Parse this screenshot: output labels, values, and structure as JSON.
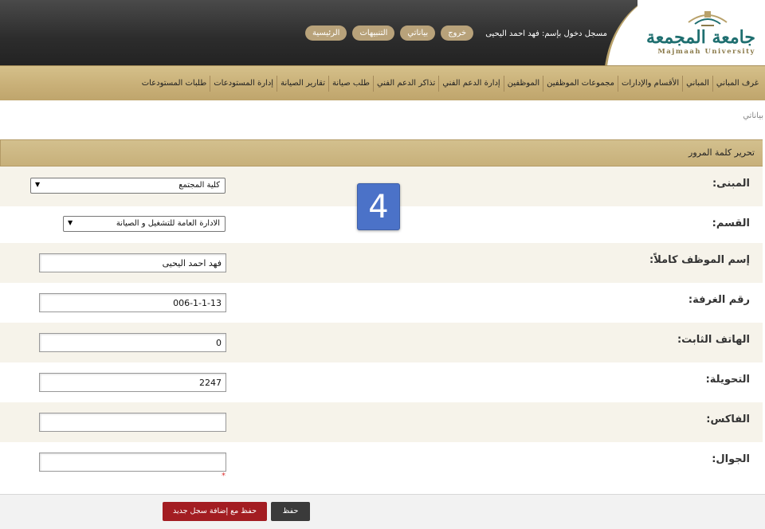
{
  "header": {
    "logo_arabic": "جامعة المجمعة",
    "logo_english": "Majmaah University",
    "logged_in_label": "مسجل دخول بإسم:",
    "user_name": "فهد احمد اليحيى",
    "links": [
      "الرئيسية",
      "التنبيهات",
      "بياناتي",
      "خروج"
    ]
  },
  "nav": {
    "items": [
      "غرف المباني",
      "المباني",
      "الأقسام والإدارات",
      "مجموعات الموظفين",
      "الموظفين",
      "إدارة الدعم الفني",
      "تذاكر الدعم الفني",
      "طلب صيانة",
      "تقارير الصيانة",
      "إدارة المستودعات",
      "طلبات المستودعات"
    ]
  },
  "breadcrumb": "بياناتي",
  "panel": {
    "title": "تحرير كلمة المرور"
  },
  "form": {
    "building_label": "المبنى:",
    "building_value": "كلية المجتمع",
    "dept_label": "القسم:",
    "dept_value": "الادارة العامة للتشغيل و الصيانة",
    "fullname_label": "إسم الموظف كاملاً:",
    "fullname_value": "فهد احمد اليحيى",
    "room_label": "رقم الغرفة:",
    "room_value": "006-1-1-13",
    "phone_label": "الهاتف الثابت:",
    "phone_value": "0",
    "ext_label": "التحويلة:",
    "ext_value": "2247",
    "fax_label": "الفاكس:",
    "fax_value": "",
    "mobile_label": "الجوال:",
    "mobile_value": "",
    "required_mark": "*"
  },
  "badge": "4",
  "buttons": {
    "save": "حفظ",
    "save_new": "حفظ مع إضافة سجل جديد"
  },
  "colors": {
    "gold": "#c7b07a",
    "header_dark": "#2c2c2c",
    "save_new": "#a31d22",
    "badge_blue": "#4b72c8"
  }
}
